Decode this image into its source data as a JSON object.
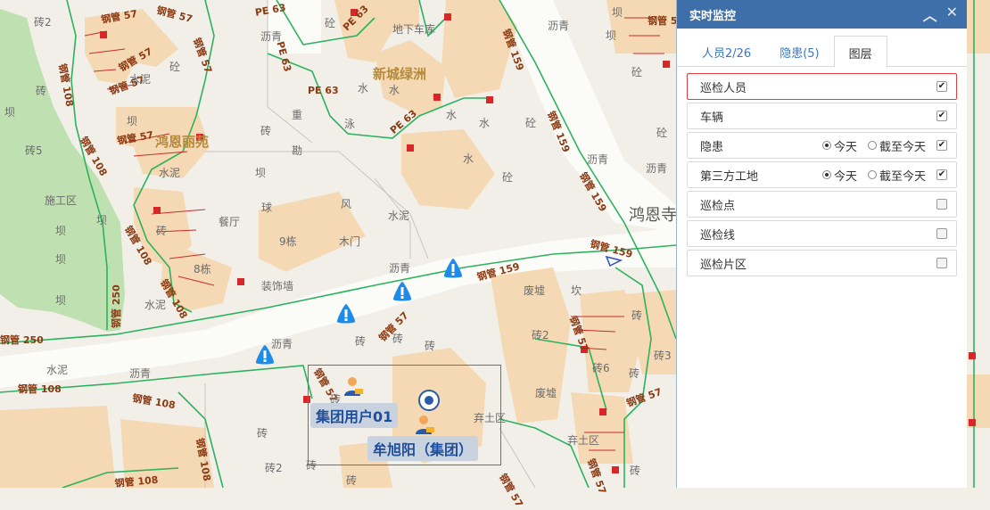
{
  "map": {
    "estate_name": "新城绿洲",
    "estate_name2": "鸿恩丽苑",
    "road_name": "鸿恩寺",
    "pipe_labels": [
      "钢管 57",
      "钢管 57",
      "钢管 57",
      "钢管 57",
      "钢管 57",
      "钢管 57",
      "钢管 108",
      "钢管 108",
      "钢管 108",
      "钢管 108",
      "钢管 250",
      "钢管 250",
      "PE 63",
      "PE 63",
      "PE 63",
      "PE 63",
      "PE 63",
      "钢管 159",
      "钢管 159",
      "钢管 159",
      "钢管 159",
      "钢管 159",
      "钢管 57",
      "钢管 57",
      "钢管 108",
      "钢管 108",
      "钢管 57",
      "钢管 57",
      "钢管 57",
      "钢管 108",
      "钢管 108",
      "钢管 57",
      "钢管 57"
    ],
    "area_labels": [
      "砖2",
      "砖",
      "坝",
      "砖5",
      "施工区",
      "坝",
      "坝",
      "坝",
      "水泥",
      "水泥",
      "砼",
      "水泥",
      "坝",
      "坝",
      "砖",
      "砖",
      "坝",
      "餐厅",
      "球",
      "9栋",
      "木门",
      "8栋",
      "装饰墙",
      "水泥",
      "风",
      "水泥",
      "沥青",
      "沥青",
      "沥青",
      "沥青",
      "砖",
      "砖",
      "砖",
      "重",
      "勘",
      "泳",
      "水",
      "水",
      "水",
      "水",
      "砼",
      "砼",
      "水",
      "地下车库",
      "砼",
      "沥青",
      "坝",
      "砼",
      "砼",
      "坝",
      "沥青",
      "沥青",
      "废墟",
      "坎",
      "砖2",
      "废墟",
      "砖",
      "砖6",
      "砖",
      "砖3",
      "弃土区",
      "砖",
      "砖2",
      "砖",
      "砖",
      "弃土区",
      "砖",
      "砖"
    ],
    "people": [
      {
        "name": "集团用户01"
      },
      {
        "name": "牟旭阳（集团）"
      }
    ]
  },
  "panel": {
    "title": "实时监控",
    "tabs": [
      {
        "label": "人员2/26",
        "active": false
      },
      {
        "label": "隐患(5)",
        "active": false
      },
      {
        "label": "图层",
        "active": true
      }
    ],
    "layers": [
      {
        "name": "巡检人员",
        "checked": true,
        "highlighted": true
      },
      {
        "name": "车辆",
        "checked": true
      },
      {
        "name": "隐患",
        "checked": true,
        "radios": [
          "今天",
          "截至今天"
        ],
        "selected": "今天"
      },
      {
        "name": "第三方工地",
        "checked": true,
        "radios": [
          "今天",
          "截至今天"
        ],
        "selected": "今天"
      },
      {
        "name": "巡检点",
        "checked": false
      },
      {
        "name": "巡检线",
        "checked": false
      },
      {
        "name": "巡检片区",
        "checked": false
      }
    ],
    "colors": {
      "header": "#3f6fa9",
      "tab_link": "#3c78c0",
      "highlight": "#e04040"
    }
  }
}
